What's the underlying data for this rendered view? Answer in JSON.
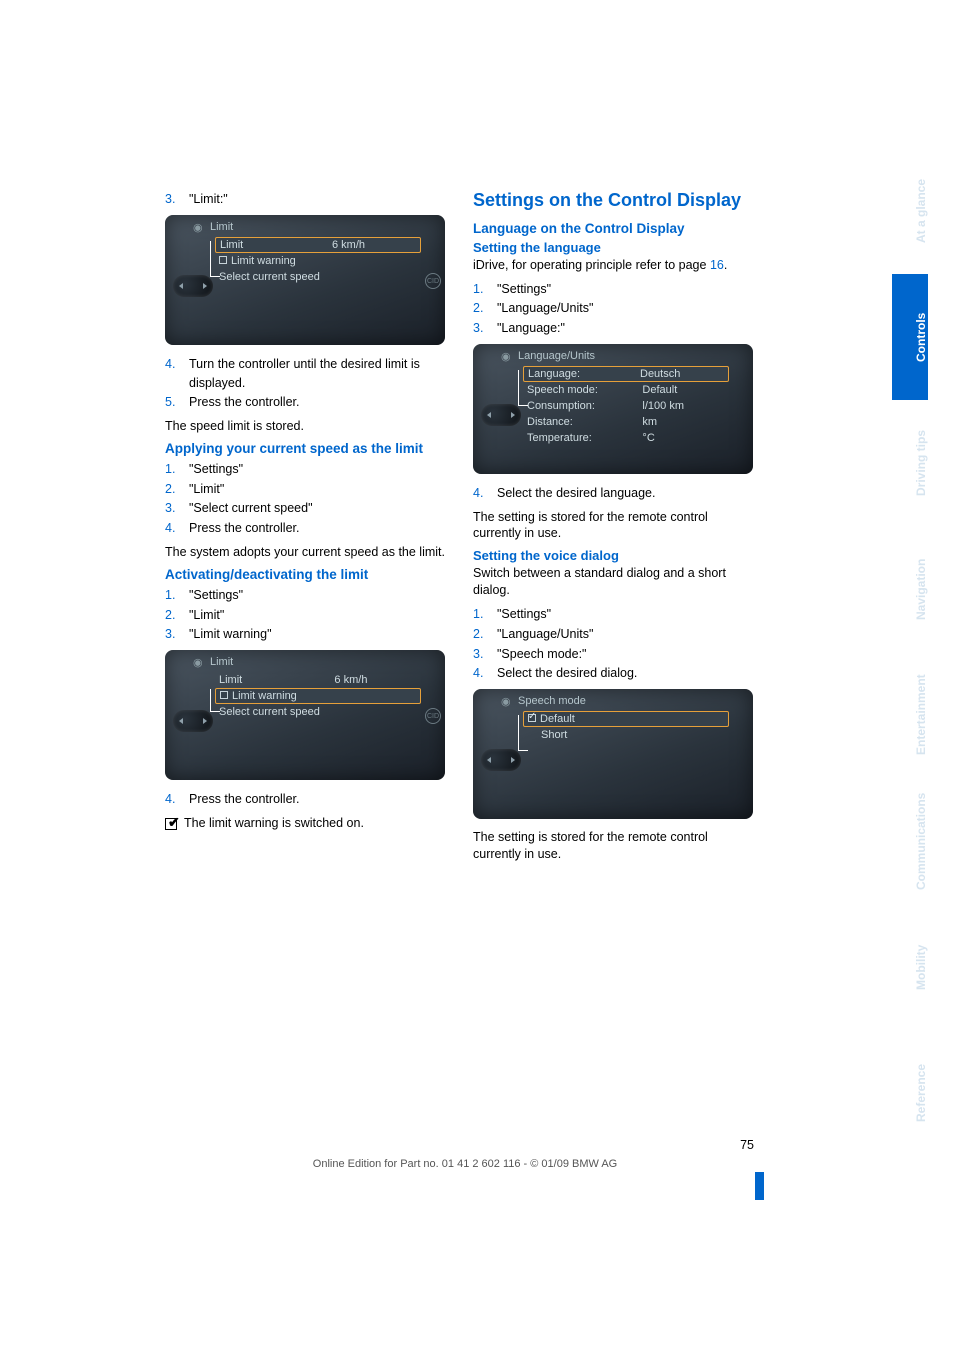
{
  "tabs": [
    "At a glance",
    "Controls",
    "Driving tips",
    "Navigation",
    "Entertainment",
    "Communications",
    "Mobility",
    "Reference"
  ],
  "active_tab": "Controls",
  "left": {
    "s3": {
      "num": "3.",
      "text": "\"Limit:\""
    },
    "fig1": {
      "head": "Limit",
      "rows": [
        {
          "l": "Limit",
          "r": "6 km/h",
          "sel": true
        },
        {
          "l": "Limit warning",
          "chk": true
        },
        {
          "l": "Select current speed"
        }
      ]
    },
    "s4": {
      "num": "4.",
      "text": "Turn the controller until the desired limit is displayed."
    },
    "s5": {
      "num": "5.",
      "text": "Press the controller."
    },
    "p1": "The speed limit is stored.",
    "h1": "Applying your current speed as the limit",
    "a": [
      {
        "num": "1.",
        "text": "\"Settings\""
      },
      {
        "num": "2.",
        "text": "\"Limit\""
      },
      {
        "num": "3.",
        "text": "\"Select current speed\""
      },
      {
        "num": "4.",
        "text": "Press the controller."
      }
    ],
    "p2": "The system adopts your current speed as the limit.",
    "h2": "Activating/deactivating the limit",
    "b": [
      {
        "num": "1.",
        "text": "\"Settings\""
      },
      {
        "num": "2.",
        "text": "\"Limit\""
      },
      {
        "num": "3.",
        "text": "\"Limit warning\""
      }
    ],
    "fig2": {
      "head": "Limit",
      "rows": [
        {
          "l": "Limit",
          "r": "6 km/h"
        },
        {
          "l": "Limit warning",
          "chk": true,
          "sel": true
        },
        {
          "l": "Select current speed"
        }
      ]
    },
    "s4b": {
      "num": "4.",
      "text": "Press the controller."
    },
    "p3": "The limit warning is switched on."
  },
  "right": {
    "h0": "Settings on the Control Display",
    "h1": "Language on the Control Display",
    "h1a": "Setting the language",
    "p1a": "iDrive, for operating principle refer to page ",
    "p1link": "16",
    "p1b": ".",
    "a": [
      {
        "num": "1.",
        "text": "\"Settings\""
      },
      {
        "num": "2.",
        "text": "\"Language/Units\""
      },
      {
        "num": "3.",
        "text": "\"Language:\""
      }
    ],
    "fig1": {
      "head": "Language/Units",
      "rows": [
        {
          "l": "Language:",
          "r": "Deutsch",
          "sel": true
        },
        {
          "l": "Speech mode:",
          "r": "Default"
        },
        {
          "l": "Consumption:",
          "r": "l/100 km"
        },
        {
          "l": "Distance:",
          "r": "km"
        },
        {
          "l": "Temperature:",
          "r": "°C"
        }
      ]
    },
    "s4": {
      "num": "4.",
      "text": "Select the desired language."
    },
    "p2": "The setting is stored for the remote control currently in use.",
    "h2": "Setting the voice dialog",
    "p3": "Switch between a standard dialog and a short dialog.",
    "b": [
      {
        "num": "1.",
        "text": "\"Settings\""
      },
      {
        "num": "2.",
        "text": "\"Language/Units\""
      },
      {
        "num": "3.",
        "text": "\"Speech mode:\""
      },
      {
        "num": "4.",
        "text": "Select the desired dialog."
      }
    ],
    "fig2": {
      "head": "Speech mode",
      "rows": [
        {
          "l": "Default",
          "tick": true,
          "sel": true
        },
        {
          "l": "Short"
        }
      ]
    },
    "p4": "The setting is stored for the remote control currently in use."
  },
  "page_num": "75",
  "footer": "Online Edition for Part no. 01 41 2 602 116 - © 01/09 BMW AG"
}
